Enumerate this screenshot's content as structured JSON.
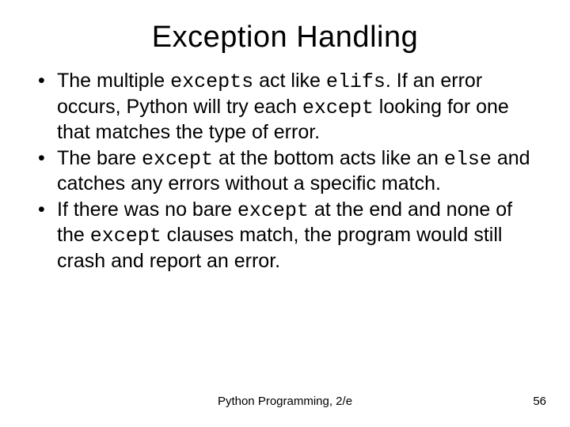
{
  "title": "Exception Handling",
  "bullets": [
    {
      "segments": [
        {
          "t": "The multiple "
        },
        {
          "t": "excepts",
          "mono": true
        },
        {
          "t": " act like "
        },
        {
          "t": "elifs",
          "mono": true
        },
        {
          "t": ". If an error occurs, Python will try each "
        },
        {
          "t": "except",
          "mono": true
        },
        {
          "t": " looking for one that matches the type of error."
        }
      ]
    },
    {
      "segments": [
        {
          "t": "The bare "
        },
        {
          "t": "except",
          "mono": true
        },
        {
          "t": " at the bottom acts like an "
        },
        {
          "t": "else",
          "mono": true
        },
        {
          "t": " and catches any errors without a specific match."
        }
      ]
    },
    {
      "segments": [
        {
          "t": "If there was no bare "
        },
        {
          "t": "except",
          "mono": true
        },
        {
          "t": "  at the end and none of the "
        },
        {
          "t": "except",
          "mono": true
        },
        {
          "t": " clauses match, the program would still crash and report an error."
        }
      ]
    }
  ],
  "footer": {
    "center": "Python Programming, 2/e",
    "page": "56"
  }
}
